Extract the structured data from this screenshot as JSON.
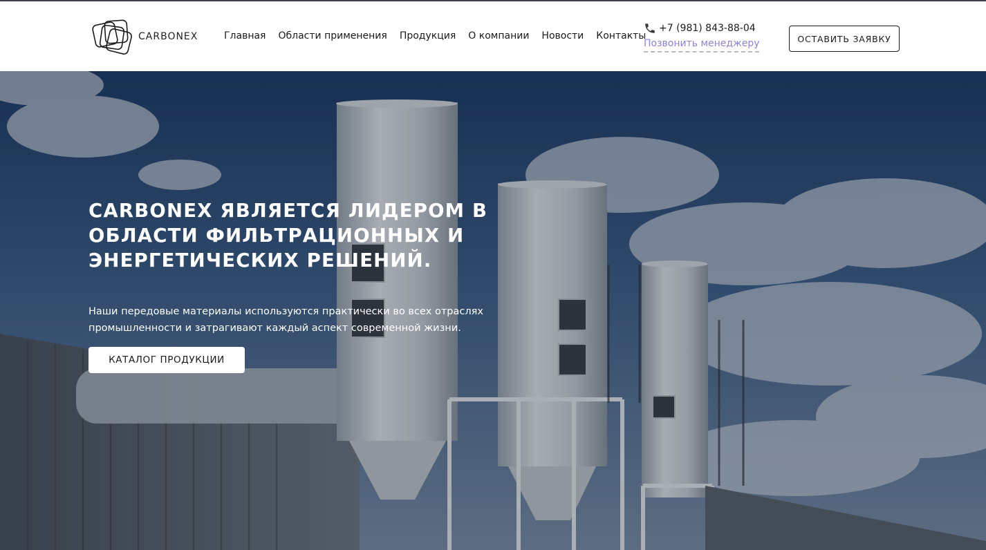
{
  "brand": {
    "name": "CARBONEX"
  },
  "nav": [
    {
      "label": "Главная"
    },
    {
      "label": "Области применения"
    },
    {
      "label": "Продукция"
    },
    {
      "label": "О компании"
    },
    {
      "label": "Новости"
    },
    {
      "label": "Контакты"
    }
  ],
  "contact": {
    "phone": "+7 (981) 843-88-04",
    "callback": "Позвонить менеджеру"
  },
  "header_button": "ОСТАВИТЬ ЗАЯВКУ",
  "hero": {
    "title": "CARBONEX ЯВЛЯЕТСЯ ЛИДЕРОМ В ОБЛАСТИ ФИЛЬТРАЦИОННЫХ И ЭНЕРГЕТИЧЕСКИХ РЕШЕНИЙ.",
    "subtitle": "Наши передовые материалы используются практически во всех отраслях промышленности и затрагивают каждый аспект современной жизни.",
    "button": "КАТАЛОГ ПРОДУКЦИИ"
  },
  "colors": {
    "accent_link": "#8a84d6",
    "header_bg": "#ffffff",
    "hero_text": "#ffffff"
  },
  "icons": {
    "logo": "overlapping-squares-logo-icon",
    "phone": "phone-icon"
  }
}
